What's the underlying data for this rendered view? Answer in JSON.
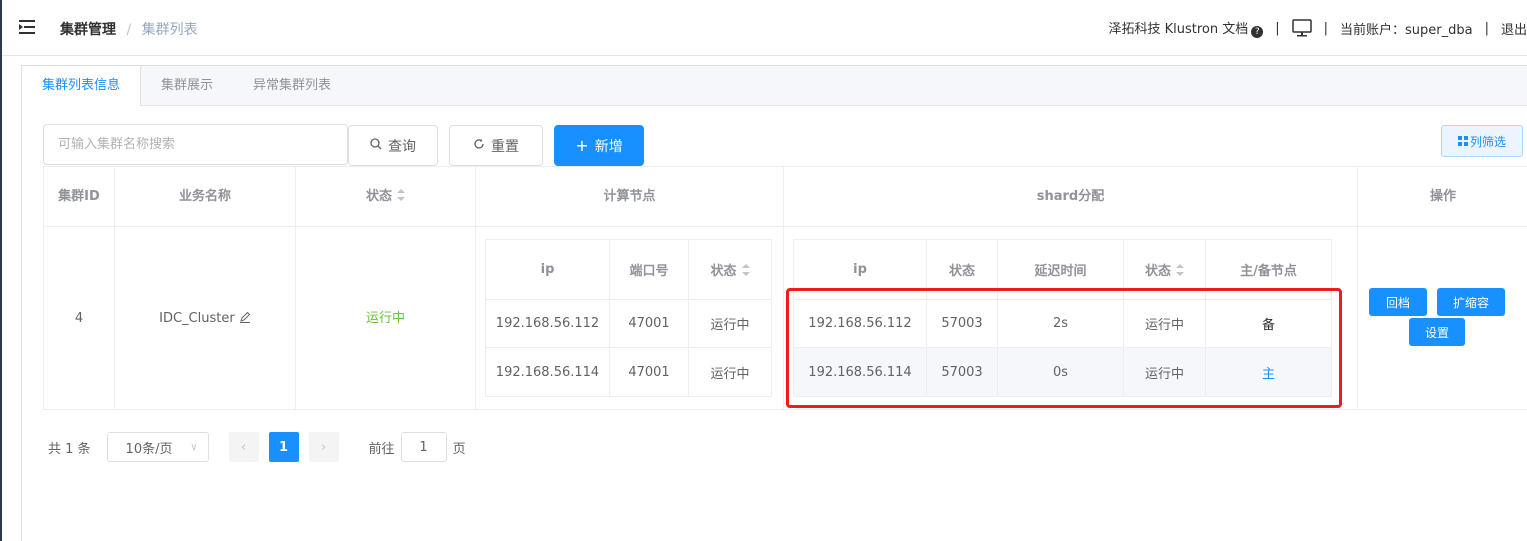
{
  "header": {
    "breadcrumb": [
      "集群管理",
      "集群列表"
    ],
    "brand_text": "泽拓科技 Klustron 文档",
    "help_glyph": "?",
    "account_label": "当前账户：super_dba",
    "logout_label": "退出"
  },
  "tabs": [
    {
      "label": "集群列表信息",
      "active": true
    },
    {
      "label": "集群展示",
      "active": false
    },
    {
      "label": "异常集群列表",
      "active": false
    }
  ],
  "toolbar": {
    "search_placeholder": "可输入集群名称搜索",
    "search_value": "",
    "query_label": "查询",
    "reset_label": "重置",
    "add_label": "新增",
    "column_filter_label": "列筛选"
  },
  "table": {
    "headers": {
      "cluster_id": "集群ID",
      "business_name": "业务名称",
      "status": "状态",
      "compute_nodes": "计算节点",
      "shard": "shard分配",
      "actions": "操作"
    },
    "row": {
      "cluster_id": "4",
      "business_name": "IDC_Cluster",
      "status": "运行中"
    },
    "compute": {
      "headers": [
        "ip",
        "端口号",
        "状态"
      ],
      "rows": [
        [
          "192.168.56.112",
          "47001",
          "运行中"
        ],
        [
          "192.168.56.114",
          "47001",
          "运行中"
        ]
      ]
    },
    "shard": {
      "headers": [
        "ip",
        "状态",
        "延迟时间",
        "状态",
        "主/备节点"
      ],
      "rows": [
        [
          "192.168.56.112",
          "57003",
          "2s",
          "运行中",
          "备"
        ],
        [
          "192.168.56.114",
          "57003",
          "0s",
          "运行中",
          "主"
        ]
      ]
    },
    "actions": [
      "回档",
      "扩缩容",
      "设置"
    ]
  },
  "pagination": {
    "total": "共 1 条",
    "page_size": "10条/页",
    "current_page": "1",
    "goto_prefix": "前往",
    "goto_value": "1",
    "goto_suffix": "页"
  },
  "colors": {
    "primary": "#1890ff",
    "success": "#67c23a",
    "highlight": "#ee1c1c"
  }
}
